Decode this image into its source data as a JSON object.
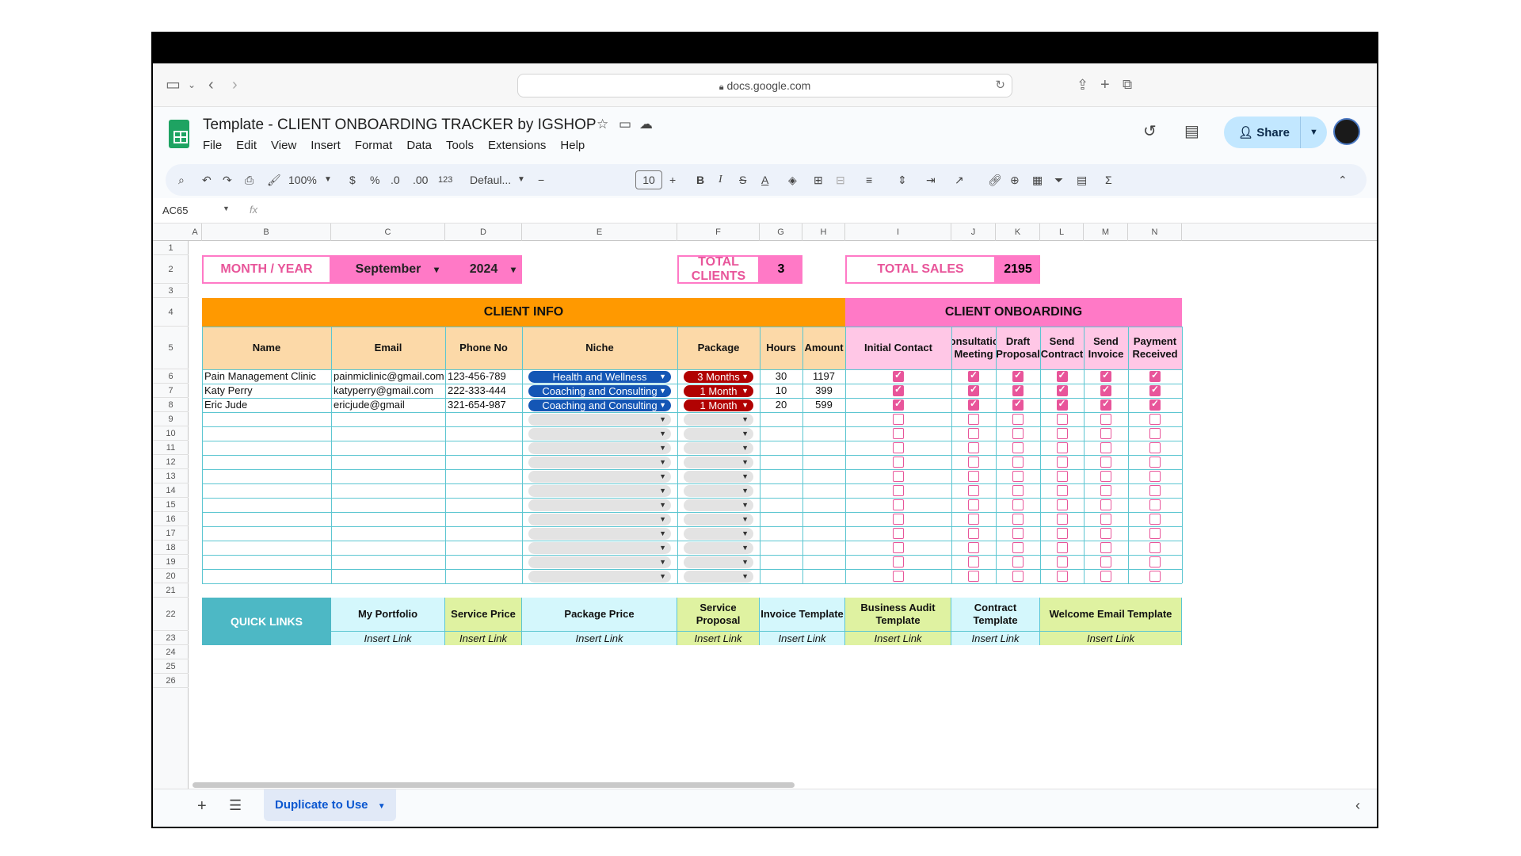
{
  "browser": {
    "url": "docs.google.com"
  },
  "doc": {
    "title": "Template - CLIENT ONBOARDING TRACKER by IGSHOP",
    "menus": [
      "File",
      "Edit",
      "View",
      "Insert",
      "Format",
      "Data",
      "Tools",
      "Extensions",
      "Help"
    ],
    "share_label": "Share"
  },
  "toolbar": {
    "zoom": "100%",
    "currency": "$",
    "percent": "%",
    "dec_dec": ".0",
    "dec_inc": ".00",
    "num_format": "123",
    "font": "Defaul...",
    "font_size": "10",
    "bold": "B",
    "italic": "I",
    "strike": "S",
    "text_color": "A"
  },
  "formula": {
    "name_box": "AC65",
    "fx": "fx"
  },
  "columns": [
    "A",
    "B",
    "C",
    "D",
    "E",
    "F",
    "G",
    "H",
    "I",
    "J",
    "K",
    "L",
    "M",
    "N"
  ],
  "rows": [
    "1",
    "2",
    "3",
    "4",
    "5",
    "6",
    "7",
    "8",
    "9",
    "10",
    "11",
    "12",
    "13",
    "14",
    "15",
    "16",
    "17",
    "18",
    "19",
    "20",
    "21",
    "22",
    "23",
    "24",
    "25",
    "26"
  ],
  "summary": {
    "month_year_label": "MONTH / YEAR",
    "month": "September",
    "year": "2024",
    "total_clients_label": "TOTAL CLIENTS",
    "total_clients": "3",
    "total_sales_label": "TOTAL SALES",
    "total_sales": "2195"
  },
  "sections": {
    "client_info": "CLIENT INFO",
    "client_onboarding": "CLIENT ONBOARDING"
  },
  "headers": [
    "Name",
    "Email",
    "Phone No",
    "Niche",
    "Package",
    "Hours",
    "Amount",
    "Initial Contact",
    "Consultation Meeting",
    "Draft Proposal",
    "Send Contract",
    "Send Invoice",
    "Payment Received"
  ],
  "clients": [
    {
      "name": "Pain Management Clinic",
      "email": "painmiclinic@gmail.com",
      "phone": "123-456-789",
      "niche": "Health and Wellness",
      "package": "3 Months",
      "hours": "30",
      "amount": "1197",
      "steps": [
        true,
        true,
        true,
        true,
        true,
        true
      ]
    },
    {
      "name": "Katy Perry",
      "email": "katyperry@gmail.com",
      "phone": "222-333-444",
      "niche": "Coaching and Consulting",
      "package": "1 Month",
      "hours": "10",
      "amount": "399",
      "steps": [
        true,
        true,
        true,
        true,
        true,
        true
      ]
    },
    {
      "name": "Eric Jude",
      "email": "ericjude@gmail",
      "phone": "321-654-987",
      "niche": "Coaching and Consulting",
      "package": "1 Month",
      "hours": "20",
      "amount": "599",
      "steps": [
        true,
        true,
        true,
        true,
        true,
        true
      ]
    }
  ],
  "quick_links": {
    "label": "QUICK LINKS",
    "items": [
      {
        "title": "My Portfolio",
        "link": "Insert Link"
      },
      {
        "title": "Service Price",
        "link": "Insert Link"
      },
      {
        "title": "Package Price",
        "link": "Insert Link"
      },
      {
        "title": "Service Proposal",
        "link": "Insert Link"
      },
      {
        "title": "Invoice Template",
        "link": "Insert Link"
      },
      {
        "title": "Business Audit Template",
        "link": "Insert Link"
      },
      {
        "title": "Contract Template",
        "link": "Insert Link"
      },
      {
        "title": "Welcome Email Template",
        "link": "Insert Link"
      }
    ]
  },
  "sheet_tab": "Duplicate to Use",
  "colors": {
    "orange": "#ff9900",
    "pink": "#ff79c6",
    "peach": "#fcd9a8",
    "light_pink": "#ffc7e6",
    "teal": "#4db8c5",
    "lime": "#dff2a1",
    "cyan": "#d4f7fc",
    "niche_blue": "#1456b5",
    "package_red": "#b10202",
    "checkbox": "#e8559a"
  }
}
